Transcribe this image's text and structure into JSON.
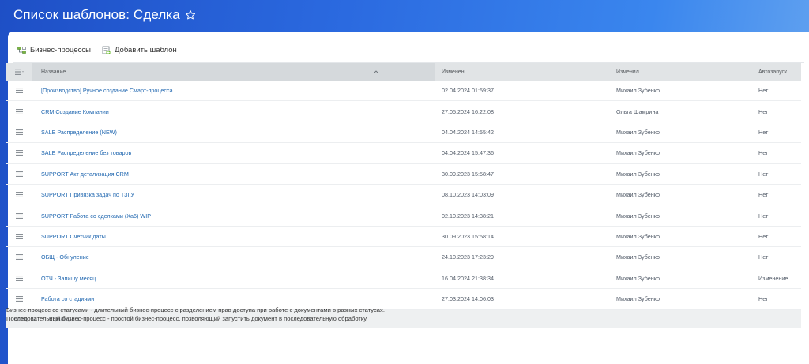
{
  "header": {
    "title": "Список шаблонов: Сделка"
  },
  "toolbar": {
    "bp_label": "Бизнес-процессы",
    "add_label": "Добавить шаблон"
  },
  "grid": {
    "columns": {
      "name": "Название",
      "changed": "Изменен",
      "changed_by": "Изменил",
      "autostart": "Автозапуск"
    },
    "rows": [
      {
        "name": "[Производство] Ручное создание Смарт-процесса",
        "changed": "02.04.2024 01:59:37",
        "changed_by": "Михаил Зубенко",
        "autostart": "Нет"
      },
      {
        "name": "CRM Создание Компании",
        "changed": "27.05.2024 16:22:08",
        "changed_by": "Ольга Шамрина",
        "autostart": "Нет"
      },
      {
        "name": "SALE Распределение (NEW)",
        "changed": "04.04.2024 14:55:42",
        "changed_by": "Михаил Зубенко",
        "autostart": "Нет"
      },
      {
        "name": "SALE Распределение без товаров",
        "changed": "04.04.2024 15:47:36",
        "changed_by": "Михаил Зубенко",
        "autostart": "Нет"
      },
      {
        "name": "SUPPORT Акт детализация CRM",
        "changed": "30.09.2023 15:58:47",
        "changed_by": "Михаил Зубенко",
        "autostart": "Нет"
      },
      {
        "name": "SUPPORT Привязка задач по ТЗГУ",
        "changed": "08.10.2023 14:03:09",
        "changed_by": "Михаил Зубенко",
        "autostart": "Нет"
      },
      {
        "name": "SUPPORT Работа со сделками (Ха6) WIP",
        "changed": "02.10.2023 14:38:21",
        "changed_by": "Михаил Зубенко",
        "autostart": "Нет"
      },
      {
        "name": "SUPPORT Счетчик даты",
        "changed": "30.09.2023 15:58:14",
        "changed_by": "Михаил Зубенко",
        "autostart": "Нет"
      },
      {
        "name": "ОБЩ - Обнуление",
        "changed": "24.10.2023 17:23:29",
        "changed_by": "Михаил Зубенко",
        "autostart": "Нет"
      },
      {
        "name": "ОТЧ - Запишу месяц",
        "changed": "16.04.2024 21:38:34",
        "changed_by": "Михаил Зубенко",
        "autostart": "Изменение"
      },
      {
        "name": "Работа со стадиями",
        "changed": "27.03.2024 14:06:03",
        "changed_by": "Михаил Зубенко",
        "autostart": "Нет"
      }
    ],
    "footer": {
      "total_label": "Всего:",
      "total_value": "11",
      "pages_label": "Страницы:",
      "pages_value": "1"
    }
  },
  "descriptions": [
    "Бизнес-процесс со статусами - длительный бизнес-процесс с разделением прав доступа при работе с документами в разных статусах.",
    "Последовательный бизнес-процесс - простой бизнес-процесс, позволяющий запустить документ в последовательную обработку."
  ],
  "colors": {
    "link": "#2067b0",
    "header_bg": "#e1e4e6",
    "accent_blue": "#2b6ae0"
  }
}
